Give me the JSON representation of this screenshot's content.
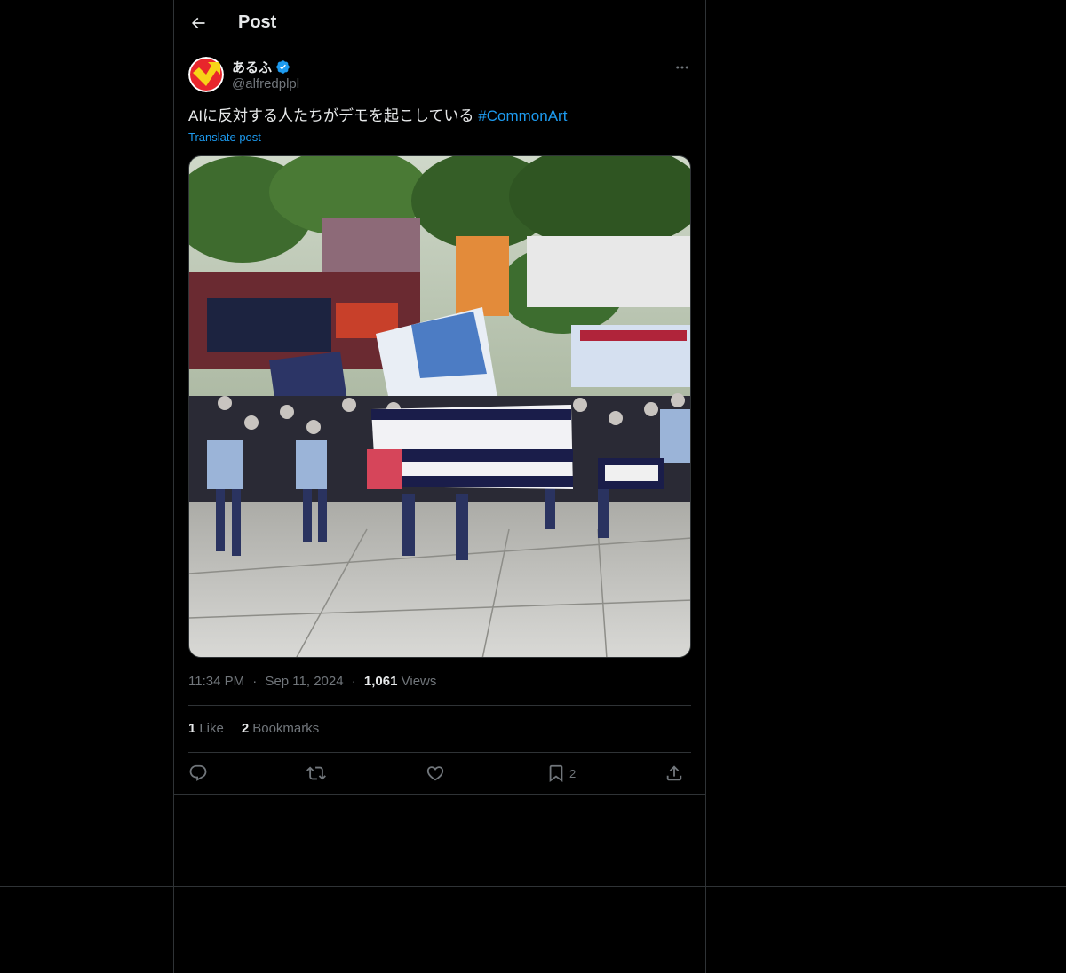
{
  "header": {
    "title": "Post",
    "back_icon": "arrow-left-icon"
  },
  "author": {
    "display_name": "あるふ",
    "handle": "@alfredplpl",
    "verified": true,
    "verified_color": "#1d9bf0"
  },
  "post": {
    "text": "AIに反対する人たちがデモを起こしている ",
    "hashtag": "#CommonArt",
    "translate_label": "Translate post",
    "media_description_icon": "photo-icon"
  },
  "meta": {
    "time": "11:34 PM",
    "separator": "·",
    "date": "Sep 11, 2024",
    "views_count": "1,061",
    "views_label": "Views"
  },
  "stats": {
    "likes_count": "1",
    "likes_label": "Like",
    "bookmarks_count": "2",
    "bookmarks_label": "Bookmarks"
  },
  "actions": {
    "reply_icon": "reply-icon",
    "repost_icon": "repost-icon",
    "like_icon": "heart-icon",
    "bookmark_icon": "bookmark-icon",
    "bookmark_count": "2",
    "share_icon": "share-icon"
  },
  "colors": {
    "background": "#000000",
    "text": "#e7e9ea",
    "muted": "#71767b",
    "accent": "#1d9bf0",
    "border": "#2f3336"
  }
}
